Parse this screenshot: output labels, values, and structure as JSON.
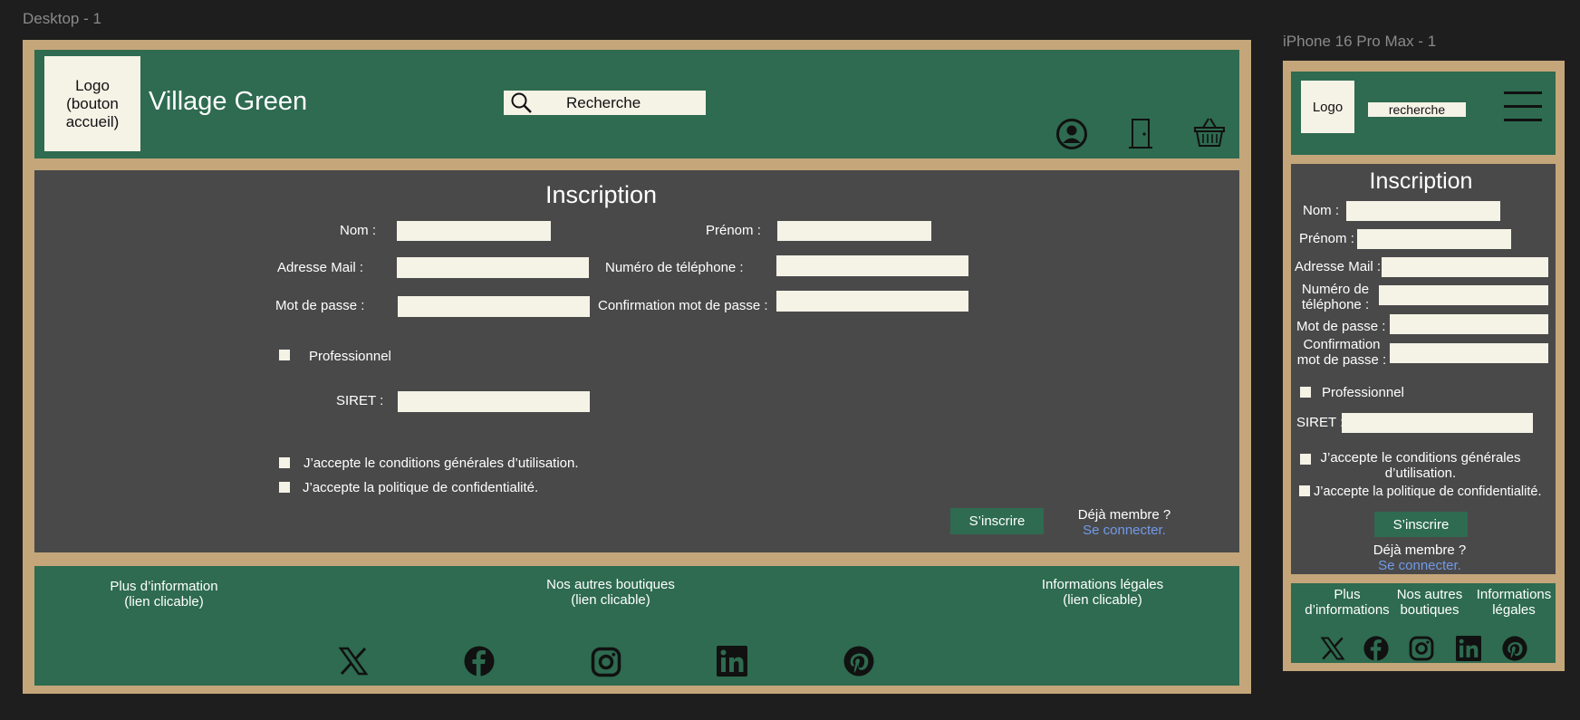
{
  "frames": {
    "desktop_label": "Desktop - 1",
    "mobile_label": "iPhone 16 Pro Max - 1"
  },
  "desktop": {
    "header": {
      "logo": "Logo\n(bouton\naccueil)",
      "site_title": "Village Green",
      "search_text": "Recherche",
      "icons": [
        "search-icon",
        "user-icon",
        "door-icon",
        "basket-icon"
      ]
    },
    "form": {
      "title": "Inscription",
      "nom": "Nom :",
      "prenom": "Prénom :",
      "mail": "Adresse Mail :",
      "telephone": "Numéro de téléphone :",
      "password": "Mot de passe :",
      "password_confirm": "Confirmation mot de passe :",
      "professionnel": "Professionnel",
      "siret": "SIRET :",
      "cgu": "J’accepte le conditions générales d’utilisation.",
      "privacy": "J’accepte la politique de confidentialité.",
      "submit": "S’inscrire",
      "already_member": "Déjà membre ?",
      "login_link": "Se connecter."
    },
    "footer": {
      "col1_title": "Plus d’information",
      "col1_sub": "(lien clicable)",
      "col2_title": "Nos autres boutiques",
      "col2_sub": "(lien clicable)",
      "col3_title": "Informations légales",
      "col3_sub": "(lien clicable)",
      "social": [
        "x-icon",
        "facebook-icon",
        "instagram-icon",
        "linkedin-icon",
        "pinterest-icon"
      ]
    }
  },
  "mobile": {
    "header": {
      "logo": "Logo",
      "search_text": "recherche",
      "icons": [
        "menu-icon"
      ]
    },
    "form": {
      "title": "Inscription",
      "nom": "Nom :",
      "prenom": "Prénom :",
      "mail": "Adresse Mail :",
      "telephone_l1": "Numéro de",
      "telephone_l2": "téléphone :",
      "password": "Mot de passe :",
      "password_confirm_l1": "Confirmation",
      "password_confirm_l2": "mot de passe :",
      "professionnel": "Professionnel",
      "siret": "SIRET :",
      "cgu_l1": "J’accepte le conditions générales",
      "cgu_l2": "d’utilisation.",
      "privacy": "J’accepte la politique de confidentialité.",
      "submit": "S’inscrire",
      "already_member": "Déjà membre ?",
      "login_link": "Se connecter."
    },
    "footer": {
      "col1_l1": "Plus",
      "col1_l2": "d’informations",
      "col2_l1": "Nos autres",
      "col2_l2": "boutiques",
      "col3_l1": "Informations",
      "col3_l2": "légales",
      "social": [
        "x-icon",
        "facebook-icon",
        "instagram-icon",
        "linkedin-icon",
        "pinterest-icon"
      ]
    }
  },
  "colors": {
    "background": "#1e1e1e",
    "frame_border": "#c4a67a",
    "green": "#2e6b50",
    "panel_gray": "#4a494a",
    "cream": "#f5f2e6",
    "link": "#6f9be8"
  }
}
